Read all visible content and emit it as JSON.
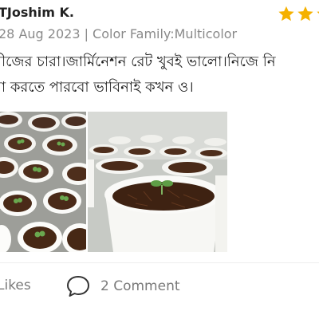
{
  "review": {
    "reviewer_name": "TJoshim K.",
    "rating_visible_stars": 2.5,
    "star_color": "#f5b100",
    "meta": "28 Aug 2023 | Color Family:Multicolor",
    "text_lines": [
      "বীজের চারা।জার্মিনেশন রেট খুবই ভালো।নিজে নি",
      "রা করতে পারবো ভাবিনাই কখন ও।"
    ],
    "photos": [
      {
        "icon": "seedling-trays-photo"
      },
      {
        "icon": "seedling-pot-photo"
      }
    ]
  },
  "actions": {
    "likes_label": "Likes",
    "comment_label": "2 Comment",
    "comment_icon": "speech-bubble-icon"
  }
}
